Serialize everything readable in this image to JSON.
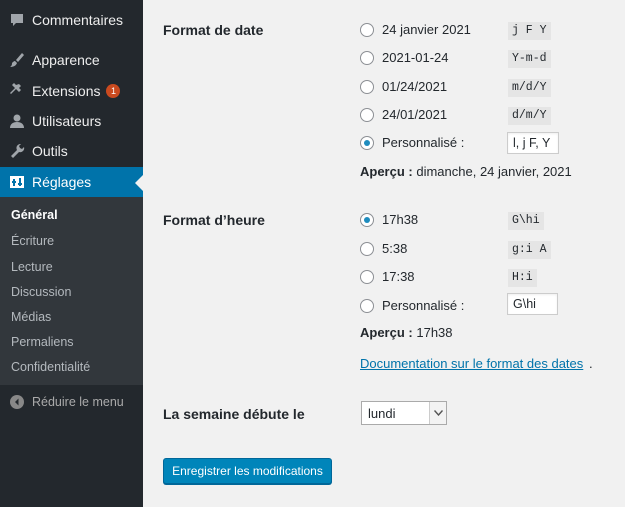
{
  "sidebar": {
    "items": [
      {
        "label": "Commentaires",
        "icon": "comment-icon"
      },
      {
        "label": "Apparence",
        "icon": "paintbrush-icon"
      },
      {
        "label": "Extensions",
        "icon": "plugin-icon",
        "badge": "1"
      },
      {
        "label": "Utilisateurs",
        "icon": "users-icon"
      },
      {
        "label": "Outils",
        "icon": "wrench-icon"
      },
      {
        "label": "Réglages",
        "icon": "settings-icon"
      }
    ],
    "submenu": [
      "Général",
      "Écriture",
      "Lecture",
      "Discussion",
      "Médias",
      "Permaliens",
      "Confidentialité"
    ],
    "collapse_label": "Réduire le menu"
  },
  "date_format": {
    "label": "Format de date",
    "options": [
      {
        "label": "24 janvier 2021",
        "code": "j F Y",
        "checked": false
      },
      {
        "label": "2021-01-24",
        "code": "Y-m-d",
        "checked": false
      },
      {
        "label": "01/24/2021",
        "code": "m/d/Y",
        "checked": false
      },
      {
        "label": "24/01/2021",
        "code": "d/m/Y",
        "checked": false
      },
      {
        "label": "Personnalisé :",
        "checked": true
      }
    ],
    "custom_value": "l, j F, Y",
    "preview_label": "Aperçu :",
    "preview_value": "dimanche, 24 janvier, 2021"
  },
  "time_format": {
    "label": "Format d’heure",
    "options": [
      {
        "label": "17h38",
        "code": "G\\hi",
        "checked": true
      },
      {
        "label": "5:38",
        "code": "g:i A",
        "checked": false
      },
      {
        "label": "17:38",
        "code": "H:i",
        "checked": false
      },
      {
        "label": "Personnalisé :",
        "checked": false
      }
    ],
    "custom_value": "G\\hi",
    "preview_label": "Aperçu :",
    "preview_value": "17h38",
    "doc_link": "Documentation sur le format des dates",
    "doc_link_suffix": "."
  },
  "week_start": {
    "label": "La semaine débute le",
    "selected": "lundi"
  },
  "save_button": "Enregistrer les modifications",
  "colors": {
    "sidebar_bg": "#23282d",
    "submenu_bg": "#32373c",
    "accent": "#0073aa",
    "button": "#0085ba",
    "badge": "#ca4a1f"
  }
}
